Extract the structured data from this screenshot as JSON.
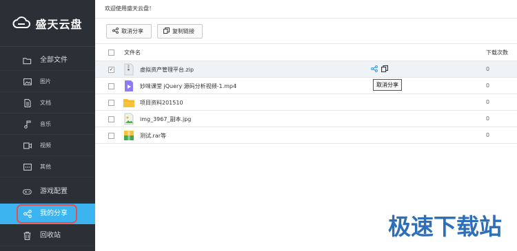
{
  "app": {
    "logo_text": "盛天云盘"
  },
  "sidebar": {
    "items": [
      {
        "label": "全部文件",
        "icon": "folder-icon"
      },
      {
        "label": "图片",
        "icon": "image-icon"
      },
      {
        "label": "文档",
        "icon": "document-icon"
      },
      {
        "label": "音乐",
        "icon": "music-icon"
      },
      {
        "label": "视频",
        "icon": "video-icon"
      },
      {
        "label": "其他",
        "icon": "other-icon"
      },
      {
        "label": "游戏配置",
        "icon": "gamepad-icon"
      },
      {
        "label": "我的分享",
        "icon": "share-icon",
        "active": true
      },
      {
        "label": "回收站",
        "icon": "trash-icon"
      }
    ],
    "active_color": "#3cb4f0",
    "bg_color": "#2b3037"
  },
  "header": {
    "welcome": "欢迎使用盛天云盘！"
  },
  "toolbar": {
    "cancel_share_label": "取消分享",
    "copy_link_label": "复制链接"
  },
  "table": {
    "columns": {
      "name": "文件名",
      "downloads": "下载次数"
    },
    "rows": [
      {
        "name": "虚拟资产管理平台.zip",
        "downloads": "0",
        "type": "zip",
        "checked": true
      },
      {
        "name": "妙味课堂 jQuery 源码分析视频-1.mp4",
        "downloads": "0",
        "type": "video",
        "checked": false
      },
      {
        "name": "项目资料201510",
        "downloads": "0",
        "type": "folder",
        "checked": false
      },
      {
        "name": "img_3967_副本.jpg",
        "downloads": "0",
        "type": "image",
        "checked": false
      },
      {
        "name": "测试.rar等",
        "downloads": "0",
        "type": "archive",
        "checked": false
      }
    ]
  },
  "tooltip": {
    "text": "取消分享"
  },
  "watermark": {
    "text": "极速下载站"
  }
}
